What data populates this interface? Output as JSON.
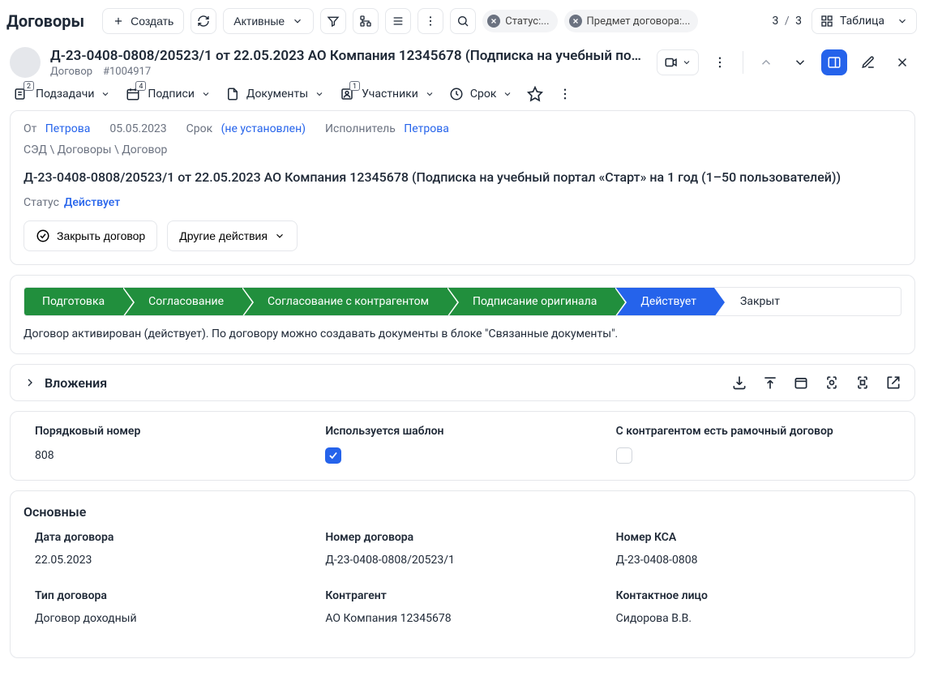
{
  "page_title": "Договоры",
  "toolbar": {
    "create": "Создать",
    "filter_state": "Активные",
    "view_label": "Таблица",
    "counter_cur": "3",
    "counter_sep": "/",
    "counter_total": "3"
  },
  "chips": {
    "status": "Статус:...",
    "subject": "Предмет договора:..."
  },
  "doc": {
    "title": "Д-23-0408-0808/20523/1 от 22.05.2023 АО Компания 12345678 (Подписка на учебный портал «Старт» на ...",
    "type_label": "Договор",
    "number_hash": "#1004917"
  },
  "tabs": {
    "subtasks": {
      "label": "Подзадачи",
      "badge": "2"
    },
    "signatures": {
      "label": "Подписи",
      "badge": "4"
    },
    "documents": {
      "label": "Документы"
    },
    "participants": {
      "label": "Участники",
      "badge": "1"
    },
    "term": {
      "label": "Срок"
    }
  },
  "meta": {
    "from_label": "От",
    "from_person": "Петрова",
    "date": "05.05.2023",
    "due_label": "Срок",
    "due_value": "(не установлен)",
    "executor_label": "Исполнитель",
    "executor_person": "Петрова",
    "crumbs": "СЭД \\ Договоры \\ Договор",
    "full_title": "Д-23-0408-0808/20523/1 от 22.05.2023 АО Компания 12345678  (Подписка на учебный портал «Старт» на 1 год (1–50 пользователей))",
    "status_label": "Статус",
    "status_value": "Действует",
    "close_btn": "Закрыть договор",
    "other_btn": "Другие действия"
  },
  "stages": [
    "Подготовка",
    "Согласование",
    "Согласование с контрагентом",
    "Подписание оригинала",
    "Действует",
    "Закрыт"
  ],
  "note": "Договор активирован (действует). По договору можно создавать документы в блоке \"Связанные документы\".",
  "attachments_header": "Вложения",
  "fields": {
    "seq_label": "Порядковый номер",
    "seq_val": "808",
    "tmpl_label": "Используется шаблон",
    "frame_label": "С контрагентом есть рамочный договор"
  },
  "main_section": "Основные",
  "main": {
    "date_label": "Дата договора",
    "date_val": "22.05.2023",
    "num_label": "Номер договора",
    "num_val": "Д-23-0408-0808/20523/1",
    "ksa_label": "Номер КСА",
    "ksa_val": "Д-23-0408-0808",
    "type_label": "Тип договора",
    "type_val": "Договор доходный",
    "cp_label": "Контрагент",
    "cp_val": "АО Компания 12345678",
    "contact_label": "Контактное лицо",
    "contact_val": "Сидорова В.В."
  }
}
